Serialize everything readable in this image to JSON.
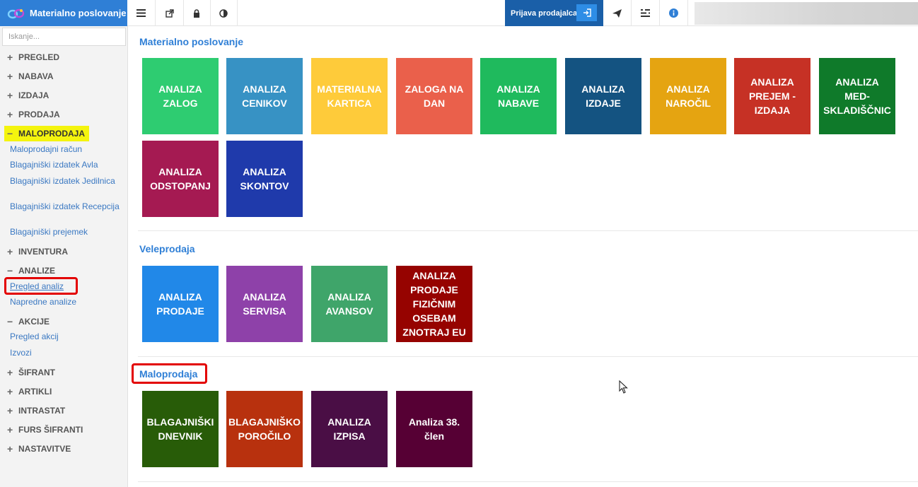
{
  "app": {
    "title": "Materialno poslovanje"
  },
  "toolbar": {
    "buttons": [
      "list-icon",
      "external-link-icon",
      "lock-icon",
      "contrast-icon"
    ],
    "prijava_label": "Prijava prodajalca",
    "right_icons": [
      "send-icon",
      "settings-icon",
      "info-icon"
    ]
  },
  "sidebar": {
    "search_placeholder": "Iskanje...",
    "sections": {
      "pregled": "PREGLED",
      "nabava": "NABAVA",
      "izdaja": "IZDAJA",
      "prodaja": "PRODAJA",
      "maloprodaja": "MALOPRODAJA",
      "inventura": "INVENTURA",
      "analize": "ANALIZE",
      "akcije": "AKCIJE",
      "sifrant": "ŠIFRANT",
      "artikli": "ARTIKLI",
      "intrastat": "INTRASTAT",
      "furs": "FURS ŠIFRANTI",
      "nastavitve": "NASTAVITVE"
    },
    "maloprodaja_items": [
      "Maloprodajni račun",
      "Blagajniški izdatek Avla",
      "Blagajniški izdatek Jedilnica",
      "Blagajniški izdatek Recepcija",
      "Blagajniški prejemek"
    ],
    "analize_items": [
      "Pregled analiz",
      "Napredne analize"
    ],
    "akcije_items": [
      "Pregled akcij",
      "Izvozi"
    ]
  },
  "groups": [
    {
      "title": "Materialno poslovanje",
      "tiles": [
        {
          "label": "ANALIZA ZALOG",
          "color": "#2ecc71"
        },
        {
          "label": "ANALIZA CENIKOV",
          "color": "#3792c4"
        },
        {
          "label": "MATERIALNA KARTICA",
          "color": "#fecb3a"
        },
        {
          "label": "ZALOGA NA DAN",
          "color": "#ea604b"
        },
        {
          "label": "ANALIZA NABAVE",
          "color": "#1fba5d"
        },
        {
          "label": "ANALIZA IZDAJE",
          "color": "#145381"
        },
        {
          "label": "ANALIZA NAROČIL",
          "color": "#e5a411"
        },
        {
          "label": "ANALIZA PREJEM - IZDAJA",
          "color": "#c63125"
        },
        {
          "label": "ANALIZA MED-SKLADIŠČNIC",
          "color": "#0f7a2a"
        },
        {
          "label": "ANALIZA ODSTOPANJ",
          "color": "#a51a52"
        },
        {
          "label": "ANALIZA SKONTOV",
          "color": "#1f3aab"
        }
      ]
    },
    {
      "title": "Veleprodaja",
      "tiles": [
        {
          "label": "ANALIZA PRODAJE",
          "color": "#2188e8"
        },
        {
          "label": "ANALIZA SERVISA",
          "color": "#8e41a9"
        },
        {
          "label": "ANALIZA AVANSOV",
          "color": "#3fa56a"
        },
        {
          "label": "ANALIZA PRODAJE FIZIČNIM OSEBAM ZNOTRAJ EU",
          "color": "#960300"
        }
      ]
    },
    {
      "title": "Maloprodaja",
      "tiles": [
        {
          "label": "BLAGAJNIŠKI DNEVNIK",
          "color": "#285c08"
        },
        {
          "label": "BLAGAJNIŠKO POROČILO",
          "color": "#b8310e"
        },
        {
          "label": "ANALIZA IZPISA",
          "color": "#4a0e45"
        },
        {
          "label": "Analiza 38. člen",
          "color": "#560034"
        }
      ]
    }
  ]
}
